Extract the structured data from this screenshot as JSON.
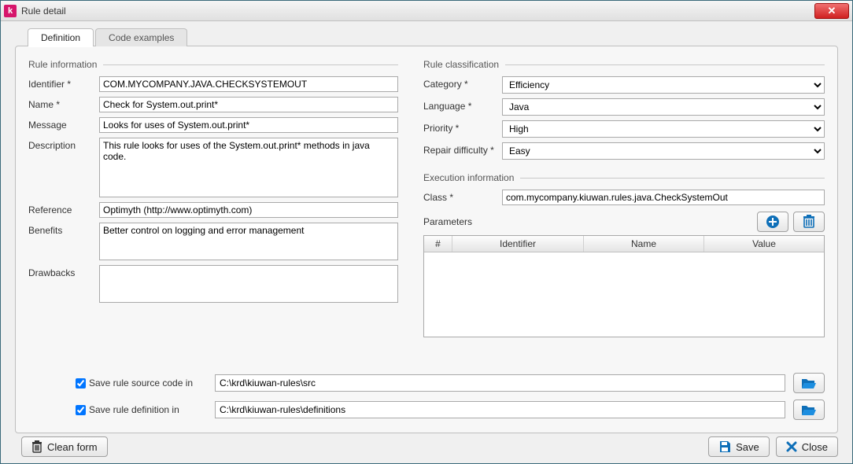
{
  "window": {
    "title": "Rule detail",
    "app_icon_letter": "k"
  },
  "tabs": {
    "definition": "Definition",
    "code_examples": "Code examples"
  },
  "sections": {
    "rule_information": "Rule information",
    "rule_classification": "Rule classification",
    "execution_information": "Execution information"
  },
  "labels": {
    "identifier": "Identifier *",
    "name": "Name *",
    "message": "Message",
    "description": "Description",
    "reference": "Reference",
    "benefits": "Benefits",
    "drawbacks": "Drawbacks",
    "category": "Category *",
    "language": "Language *",
    "priority": "Priority *",
    "repair_difficulty": "Repair difficulty *",
    "class": "Class *",
    "parameters": "Parameters"
  },
  "fields": {
    "identifier": "COM.MYCOMPANY.JAVA.CHECKSYSTEMOUT",
    "name": "Check for System.out.print*",
    "message": "Looks for uses of System.out.print*",
    "description": "This rule looks for uses of the System.out.print* methods in java code.",
    "reference": "Optimyth (http://www.optimyth.com)",
    "benefits": "Better control on logging and error management",
    "drawbacks": "",
    "category": "Efficiency",
    "language": "Java",
    "priority": "High",
    "repair_difficulty": "Easy",
    "class": "com.mycompany.kiuwan.rules.java.CheckSystemOut"
  },
  "param_table": {
    "col_num": "#",
    "col_identifier": "Identifier",
    "col_name": "Name",
    "col_value": "Value",
    "rows": []
  },
  "save_paths": {
    "save_source_label": "Save rule source code in",
    "save_source_path": "C:\\krd\\kiuwan-rules\\src",
    "save_source_checked": true,
    "save_def_label": "Save rule definition in",
    "save_def_path": "C:\\krd\\kiuwan-rules\\definitions",
    "save_def_checked": true
  },
  "buttons": {
    "clean_form": "Clean form",
    "save": "Save",
    "close": "Close"
  }
}
